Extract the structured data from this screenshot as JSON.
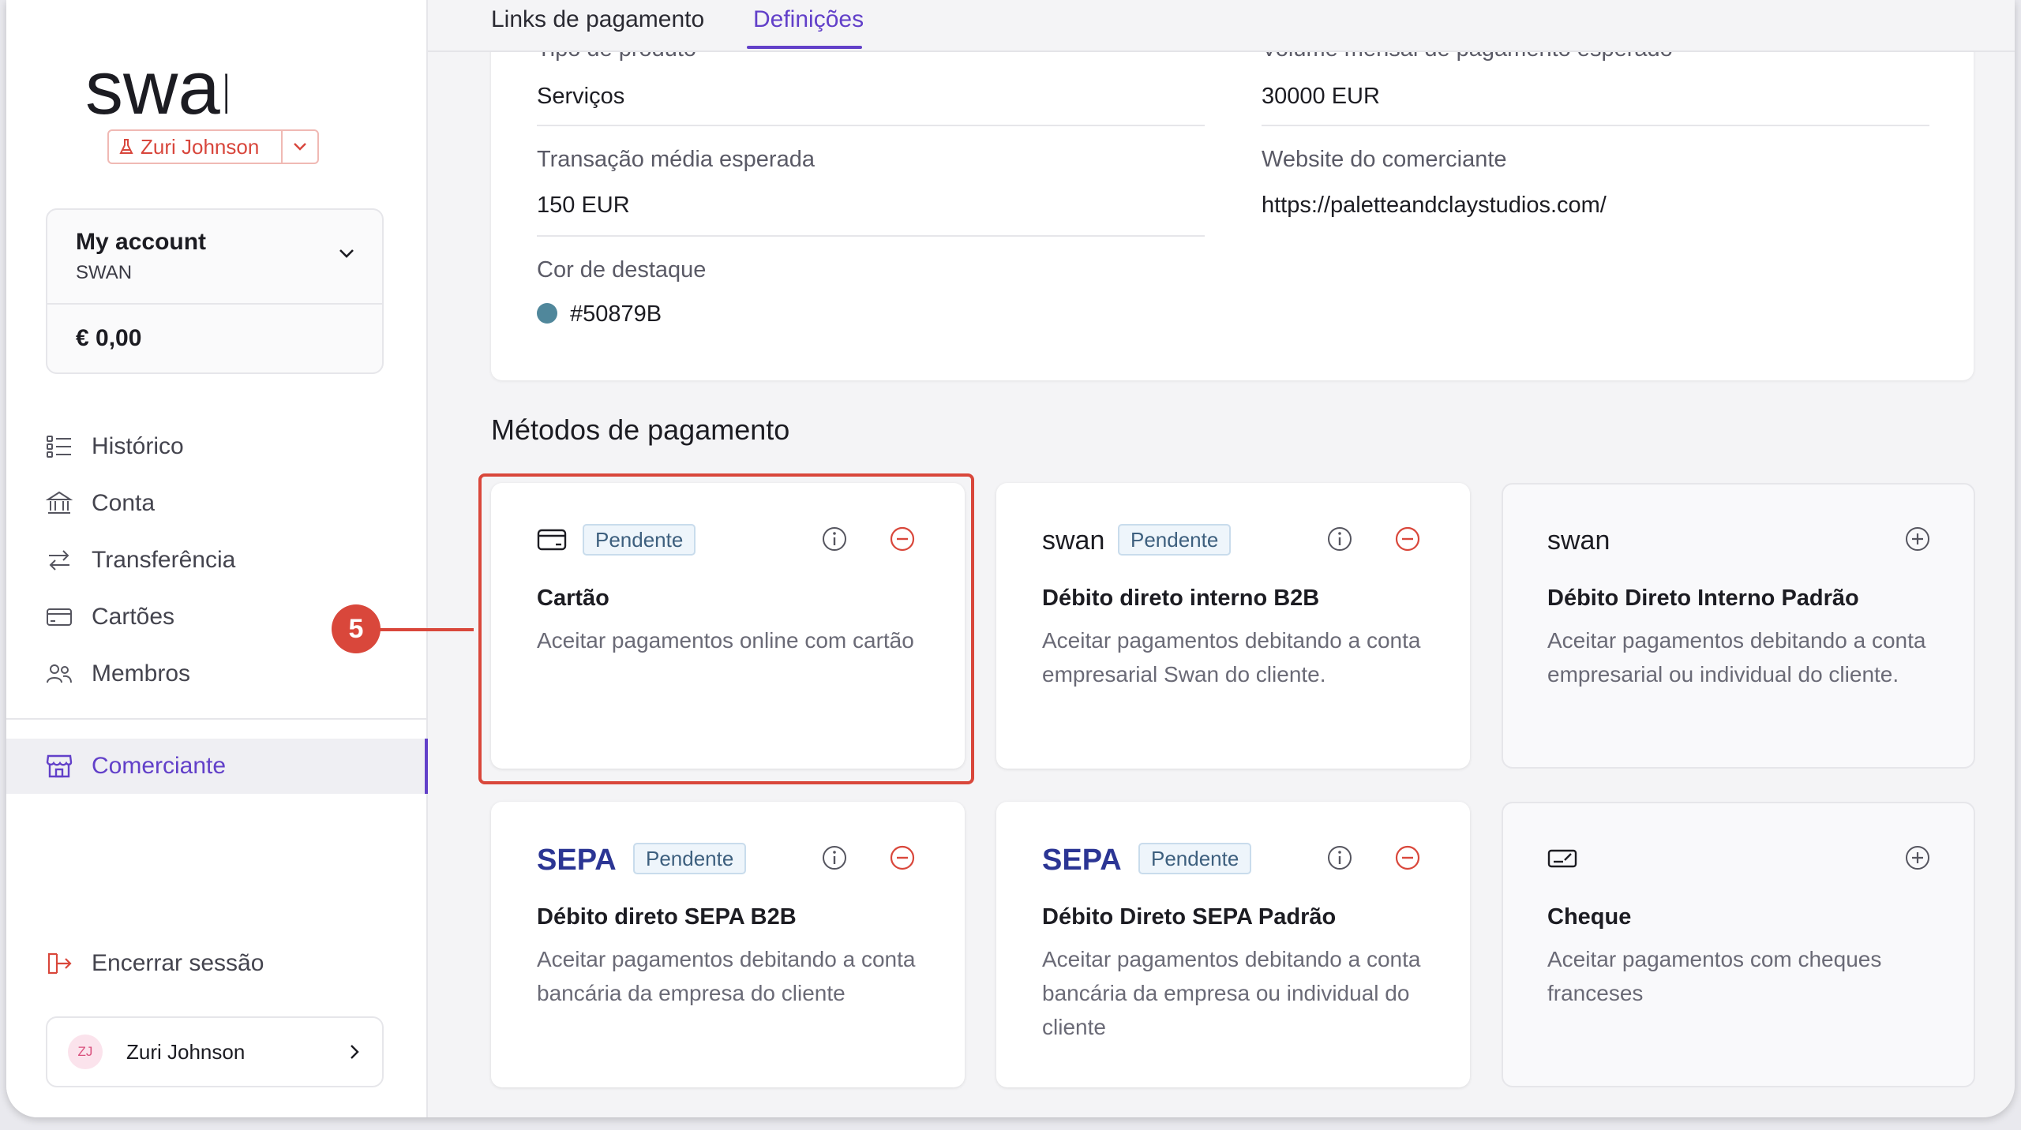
{
  "brand": {
    "logo_text": "swan",
    "accent": "#6240C9",
    "danger": "#D9473B"
  },
  "sidebar": {
    "environment_user": "Zuri Johnson",
    "account": {
      "title": "My account",
      "subtitle": "SWAN",
      "balance": "€ 0,00"
    },
    "items": [
      {
        "label": "Histórico",
        "icon": "list-icon"
      },
      {
        "label": "Conta",
        "icon": "bank-icon"
      },
      {
        "label": "Transferência",
        "icon": "transfer-arrows-icon"
      },
      {
        "label": "Cartões",
        "icon": "card-icon"
      },
      {
        "label": "Membros",
        "icon": "members-icon"
      }
    ],
    "active_item": {
      "label": "Comerciante",
      "icon": "store-icon"
    },
    "logout": "Encerrar sessão",
    "user": {
      "initials": "ZJ",
      "name": "Zuri Johnson"
    }
  },
  "tabs": [
    {
      "label": "Links de pagamento",
      "active": false
    },
    {
      "label": "Definições",
      "active": true
    }
  ],
  "details": {
    "product_type": {
      "label": "Tipo de produto",
      "value": "Serviços"
    },
    "monthly_volume": {
      "label": "Volume mensal de pagamento esperado",
      "value": "30000 EUR"
    },
    "avg_transaction": {
      "label": "Transação média esperada",
      "value": "150 EUR"
    },
    "website": {
      "label": "Website do comerciante",
      "value": "https://paletteandclaystudios.com/"
    },
    "accent_color": {
      "label": "Cor de destaque",
      "value": "#50879B"
    }
  },
  "payment_methods": {
    "title": "Métodos de pagamento",
    "items": [
      {
        "logo": "card-icon",
        "badge": "Pendente",
        "title": "Cartão",
        "description": "Aceitar pagamentos online com cartão",
        "action": "remove"
      },
      {
        "logo": "swan",
        "badge": "Pendente",
        "title": "Débito direto interno B2B",
        "description": "Aceitar pagamentos debitando a conta empresarial Swan do cliente.",
        "action": "remove"
      },
      {
        "logo": "swan",
        "badge": "",
        "title": "Débito Direto Interno Padrão",
        "description": "Aceitar pagamentos debitando a conta empresarial ou individual do cliente.",
        "action": "add"
      },
      {
        "logo": "SEPA",
        "badge": "Pendente",
        "title": "Débito direto SEPA B2B",
        "description": "Aceitar pagamentos debitando a conta bancária da empresa do cliente",
        "action": "remove"
      },
      {
        "logo": "SEPA",
        "badge": "Pendente",
        "title": "Débito Direto SEPA Padrão",
        "description": "Aceitar pagamentos debitando a conta bancária da empresa ou individual do cliente",
        "action": "remove"
      },
      {
        "logo": "cheque-icon",
        "badge": "",
        "title": "Cheque",
        "description": "Aceitar pagamentos com cheques franceses",
        "action": "add"
      }
    ]
  },
  "annotation": {
    "step": "5"
  }
}
